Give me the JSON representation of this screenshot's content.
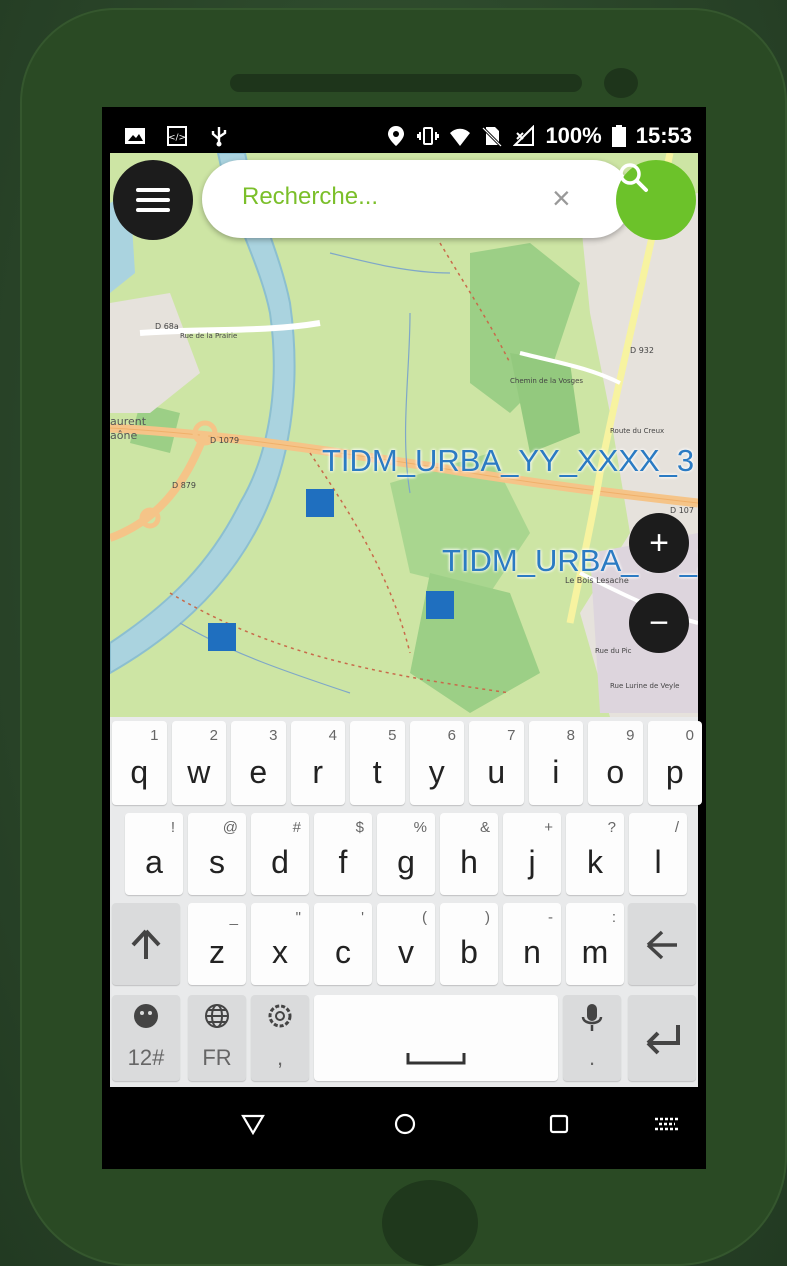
{
  "status_bar": {
    "battery_percent": "100%",
    "time": "15:53"
  },
  "search": {
    "placeholder": "Recherche...",
    "value": "",
    "clear_label": "×"
  },
  "map": {
    "feature_labels": [
      "TIDM_URBA_YY_XXXX_3",
      "TIDM_URBA_YY_X"
    ],
    "zoom_in_label": "+",
    "zoom_out_label": "−",
    "road_labels": [
      "D 68a",
      "Rue de la Prairie",
      "D 1079",
      "D 879",
      "D 932",
      "D 107",
      "Le Bois Lesache",
      "Chemin de la Vosges",
      "Route du Creux",
      "Rue du Pic",
      "Rue Lurine de Veyle",
      "aurent",
      "aône"
    ]
  },
  "keyboard": {
    "row1": [
      {
        "key": "q",
        "hint": "1"
      },
      {
        "key": "w",
        "hint": "2"
      },
      {
        "key": "e",
        "hint": "3"
      },
      {
        "key": "r",
        "hint": "4"
      },
      {
        "key": "t",
        "hint": "5"
      },
      {
        "key": "y",
        "hint": "6"
      },
      {
        "key": "u",
        "hint": "7"
      },
      {
        "key": "i",
        "hint": "8"
      },
      {
        "key": "o",
        "hint": "9"
      },
      {
        "key": "p",
        "hint": "0"
      }
    ],
    "row2": [
      {
        "key": "a",
        "hint": "!"
      },
      {
        "key": "s",
        "hint": "@"
      },
      {
        "key": "d",
        "hint": "#"
      },
      {
        "key": "f",
        "hint": "$"
      },
      {
        "key": "g",
        "hint": "%"
      },
      {
        "key": "h",
        "hint": "&"
      },
      {
        "key": "j",
        "hint": "+"
      },
      {
        "key": "k",
        "hint": "?"
      },
      {
        "key": "l",
        "hint": "/"
      }
    ],
    "row3": [
      {
        "key": "z",
        "hint": "_"
      },
      {
        "key": "x",
        "hint": "\""
      },
      {
        "key": "c",
        "hint": "'"
      },
      {
        "key": "v",
        "hint": "("
      },
      {
        "key": "b",
        "hint": ")"
      },
      {
        "key": "n",
        "hint": "-"
      },
      {
        "key": "m",
        "hint": ":"
      }
    ],
    "shift_glyph": "🡑",
    "backspace_glyph": "🡐",
    "symbols_label": "12#",
    "language_label": "FR",
    "settings_sub": ",",
    "mic_sub": ".",
    "enter_glyph": "↵"
  },
  "colors": {
    "accent_green": "#6cc22a",
    "marker_blue": "#1f6fbf",
    "label_blue": "#2b7bc3"
  }
}
